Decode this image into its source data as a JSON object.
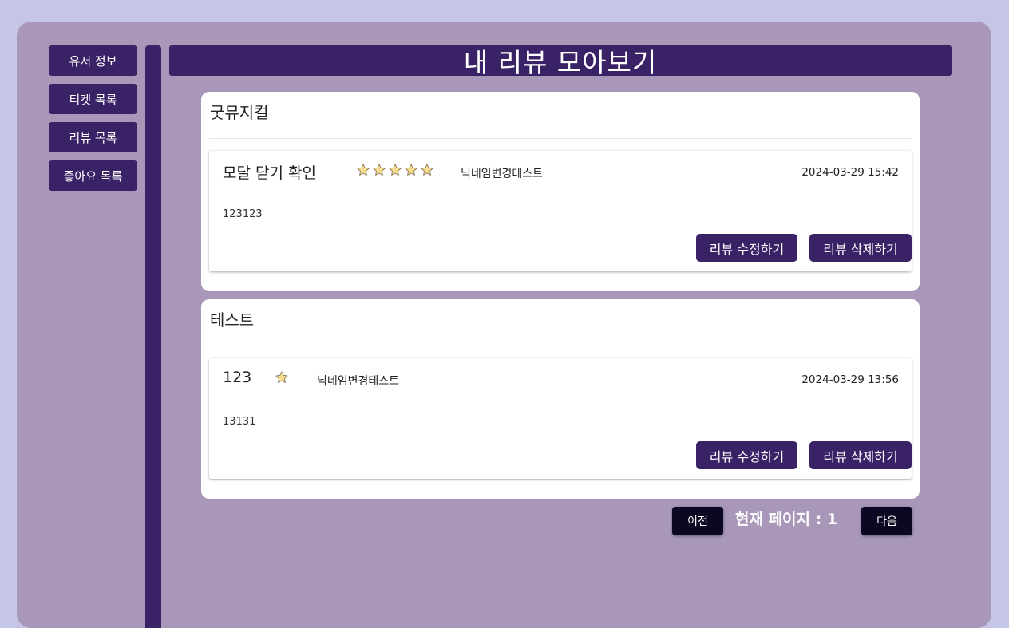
{
  "sidebar": {
    "items": [
      {
        "label": "유저 정보"
      },
      {
        "label": "티켓 목록"
      },
      {
        "label": "리뷰 목록"
      },
      {
        "label": "좋아요 목록"
      }
    ]
  },
  "header": {
    "title": "내 리뷰 모아보기"
  },
  "reviews": [
    {
      "show_title": "굿뮤지컬",
      "review_title": "모달 닫기 확인",
      "rating": 5,
      "nickname": "닉네임변경테스트",
      "date": "2024-03-29 15:42",
      "content": "123123",
      "edit_label": "리뷰 수정하기",
      "delete_label": "리뷰 삭제하기"
    },
    {
      "show_title": "테스트",
      "review_title": "123",
      "rating": 1,
      "nickname": "닉네임변경테스트",
      "date": "2024-03-29 13:56",
      "content": "13131",
      "edit_label": "리뷰 수정하기",
      "delete_label": "리뷰 삭제하기"
    }
  ],
  "pager": {
    "prev_label": "이전",
    "current_text": "현재 페이지 : 1",
    "next_label": "다음"
  },
  "colors": {
    "background": "#c5c6e7",
    "panel": "#a897b9",
    "accent": "#3a2266",
    "pager_button": "#0c0722",
    "star_fill": "#f6dc8c"
  }
}
